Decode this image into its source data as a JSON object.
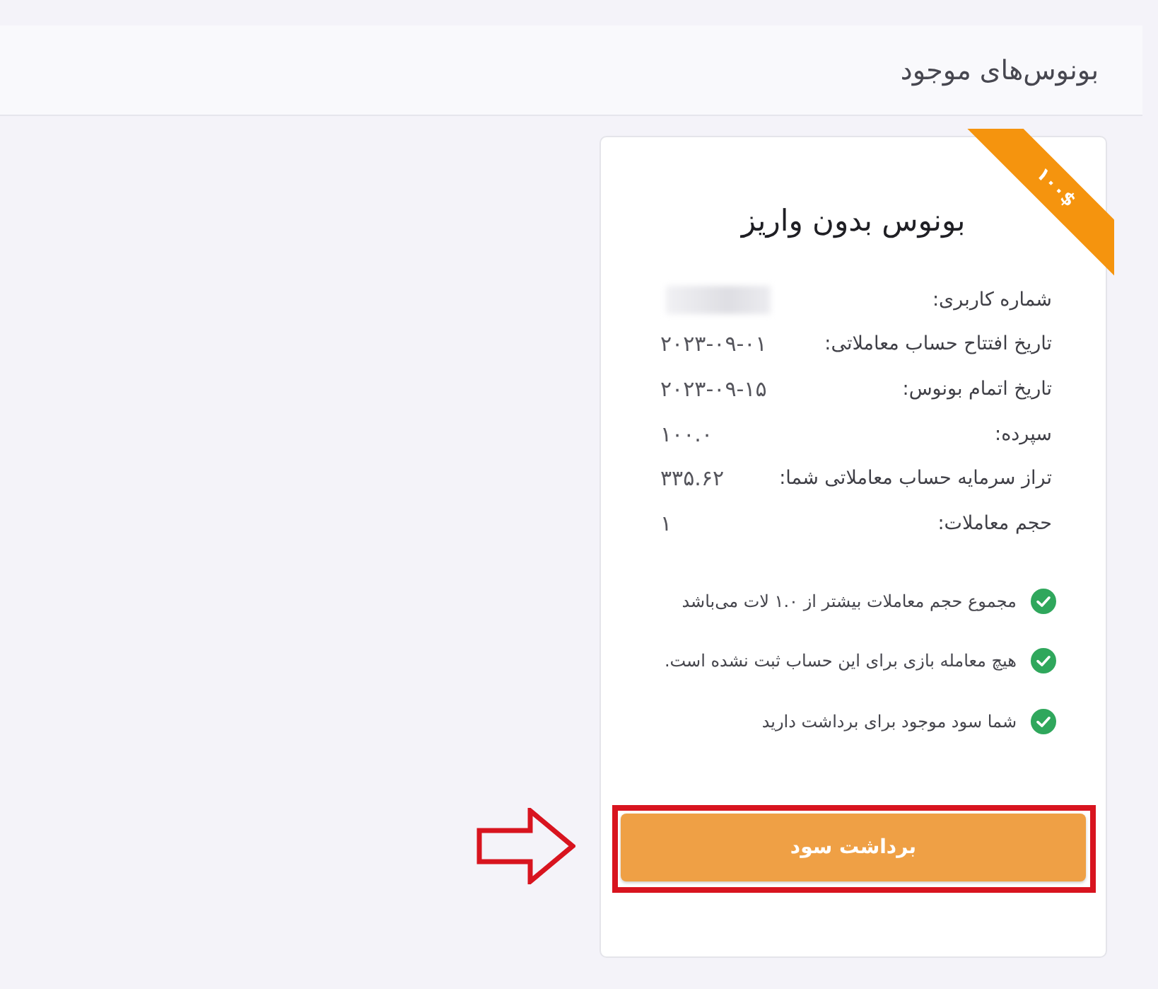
{
  "header": {
    "title": "بونوس‌های موجود"
  },
  "card": {
    "ribbon": "۱۰۰$",
    "title": "بونوس بدون واریز",
    "details": [
      {
        "label": "شماره کاربری:",
        "blurred": true
      },
      {
        "label": "تاریخ افتتاح حساب معاملاتی:",
        "value": "۲۰۲۳-۰۹-۰۱",
        "blurred": false
      },
      {
        "label": "تاریخ اتمام بونوس:",
        "value": "۲۰۲۳-۰۹-۱۵",
        "blurred": false
      },
      {
        "label": "سپرده:",
        "value": "۱۰۰.۰",
        "blurred": false
      },
      {
        "label": "تراز سرمایه حساب معاملاتی شما:",
        "value": "۳۳۵.۶۲",
        "blurred": false
      },
      {
        "label": "حجم معاملات:",
        "value": "۱",
        "blurred": false
      }
    ],
    "conditions": [
      {
        "text": "مجموع حجم معاملات بیشتر از ۱.۰ لات می‌باشد",
        "met": true
      },
      {
        "text": "هیچ معامله بازی برای این حساب ثبت نشده است.",
        "met": true
      },
      {
        "text": "شما سود موجود برای برداشت دارید",
        "met": true
      }
    ],
    "button": {
      "label": "برداشت سود"
    }
  }
}
